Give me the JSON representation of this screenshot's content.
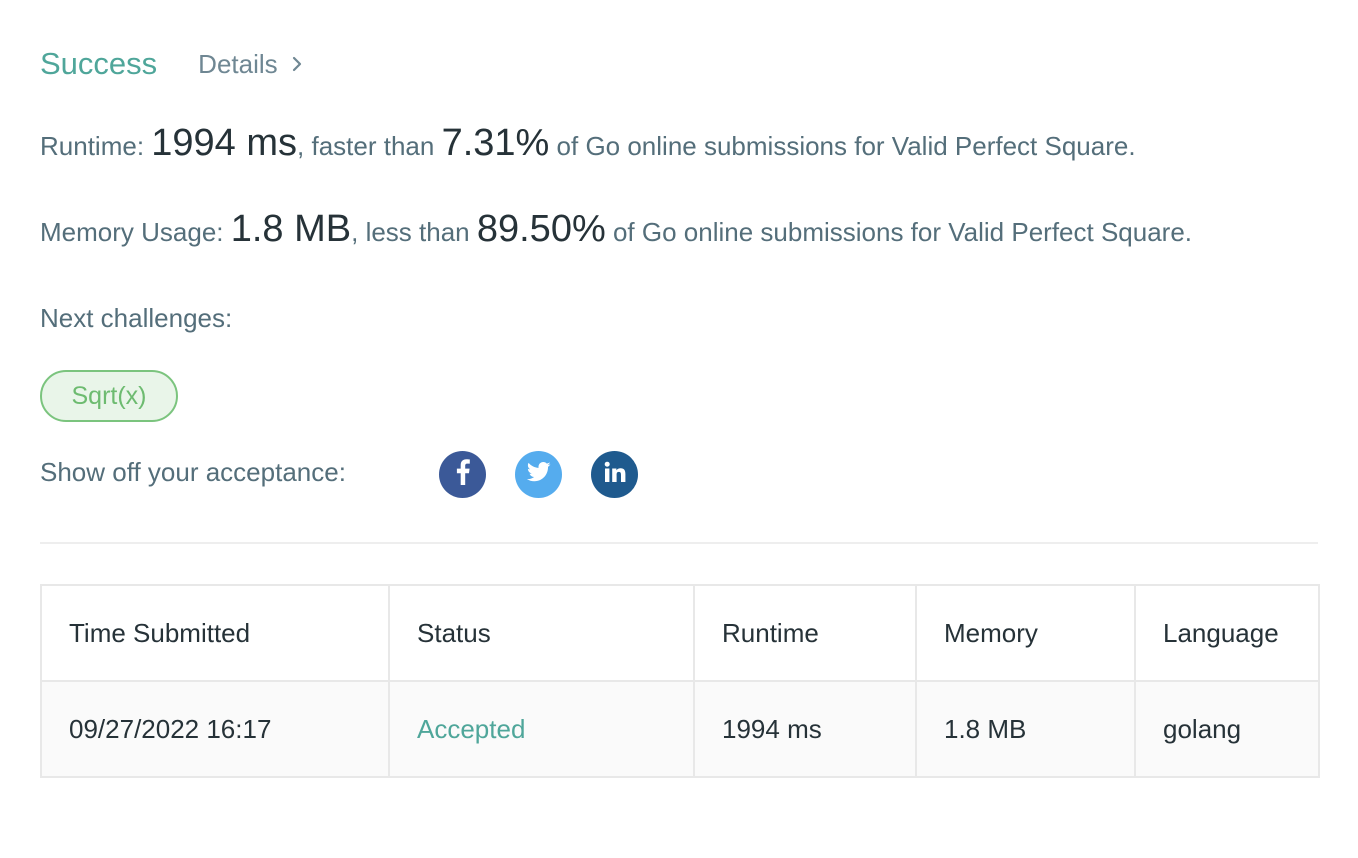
{
  "header": {
    "status": "Success",
    "details_label": "Details"
  },
  "runtime": {
    "label": "Runtime:",
    "value": "1994 ms",
    "comparison": ", faster than ",
    "percent": "7.31%",
    "suffix": " of Go online submissions for Valid Perfect Square."
  },
  "memory": {
    "label": "Memory Usage:",
    "value": "1.8 MB",
    "comparison": ", less than ",
    "percent": "89.50%",
    "suffix": " of Go online submissions for Valid Perfect Square."
  },
  "next": {
    "label": "Next challenges:",
    "challenges": [
      "Sqrt(x)"
    ]
  },
  "share": {
    "label": "Show off your acceptance:",
    "icons": [
      "facebook-icon",
      "twitter-icon",
      "linkedin-icon"
    ]
  },
  "table": {
    "headers": [
      "Time Submitted",
      "Status",
      "Runtime",
      "Memory",
      "Language"
    ],
    "rows": [
      [
        "09/27/2022 16:17",
        "Accepted",
        "1994 ms",
        "1.8 MB",
        "golang"
      ]
    ]
  },
  "colors": {
    "success": "#4fa69a",
    "chip_border": "#7bc47e",
    "chip_bg": "#e9f5e9",
    "facebook": "#3b5998",
    "twitter": "#55acee",
    "linkedin": "#1f5a8e"
  }
}
